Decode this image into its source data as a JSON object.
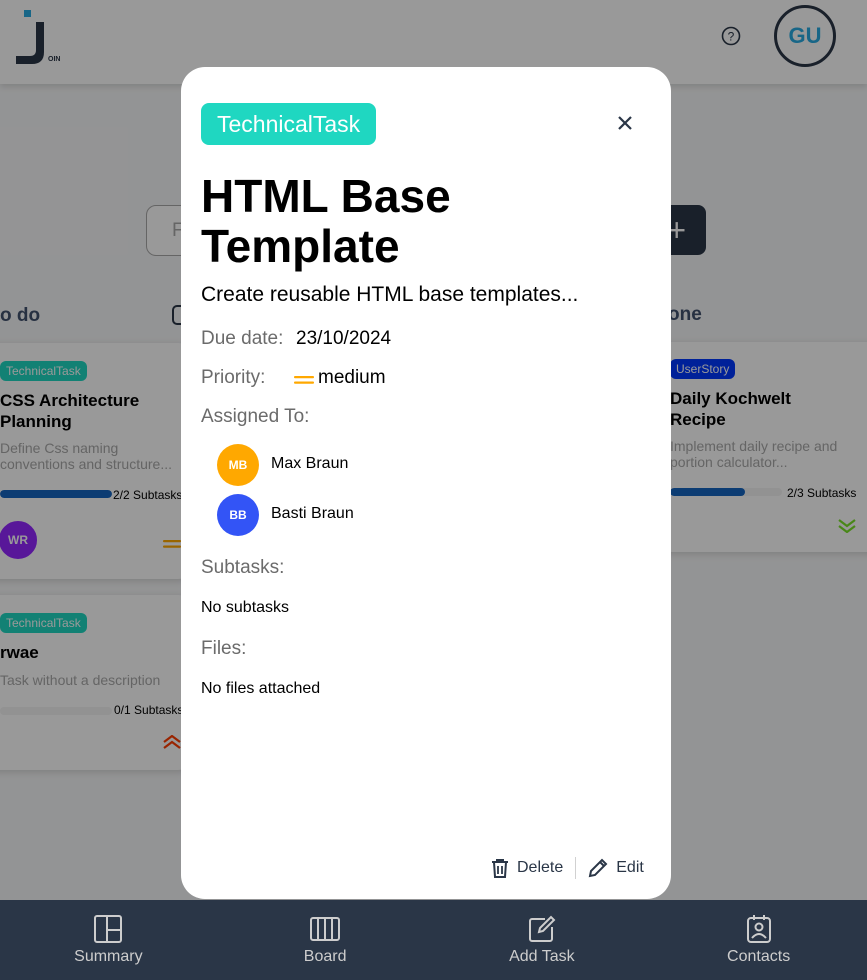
{
  "header": {
    "logo_letter": "J",
    "logo_sub": "OIN",
    "user_initials": "GU"
  },
  "board": {
    "search_placeholder": "F",
    "add_label": "+",
    "columns": [
      {
        "title": "o do"
      },
      {
        "title": "one"
      }
    ],
    "cards": [
      {
        "category": "TechnicalTask",
        "category_color": "#1fd7c1",
        "title_line1": "CSS Architecture",
        "title_line2": "Planning",
        "desc_line1": "Define Css naming",
        "desc_line2": "conventions and structure...",
        "progress": 1.0,
        "subtasks": "2/2 Subtasks",
        "avatar": "WR",
        "avatar_color": "#9327ff",
        "priority": "medium"
      },
      {
        "category": "TechnicalTask",
        "category_color": "#1fd7c1",
        "title_line1": "rwae",
        "desc_line1": "Task without a description",
        "progress": 0.0,
        "subtasks": "0/1 Subtasks",
        "priority": "urgent"
      },
      {
        "category": "UserStory",
        "category_color": "#0038ff",
        "title_line1": "Daily Kochwelt",
        "title_line2": "Recipe",
        "desc_line1": "Implement daily recipe and",
        "desc_line2": "portion calculator...",
        "progress": 0.67,
        "subtasks": "2/3 Subtasks",
        "priority": "low"
      }
    ]
  },
  "modal": {
    "category": "TechnicalTask",
    "category_color": "#1fd7c1",
    "title": "HTML Base Template",
    "description": "Create reusable HTML base templates...",
    "due_label": "Due date:",
    "due_value": "23/10/2024",
    "priority_label": "Priority:",
    "priority_value": "medium",
    "priority_color": "#ffa800",
    "assigned_label": "Assigned To:",
    "assignees": [
      {
        "initials": "MB",
        "name": "Max Braun",
        "color": "#ffa800"
      },
      {
        "initials": "BB",
        "name": "Basti Braun",
        "color": "#3354f6"
      }
    ],
    "subtasks_label": "Subtasks:",
    "subtasks_empty": "No subtasks",
    "files_label": "Files:",
    "files_empty": "No files attached",
    "delete_label": "Delete",
    "edit_label": "Edit"
  },
  "nav": {
    "items": [
      {
        "label": "Summary",
        "icon": "summary-icon"
      },
      {
        "label": "Board",
        "icon": "board-icon"
      },
      {
        "label": "Add Task",
        "icon": "add-task-icon"
      },
      {
        "label": "Contacts",
        "icon": "contacts-icon"
      }
    ]
  }
}
